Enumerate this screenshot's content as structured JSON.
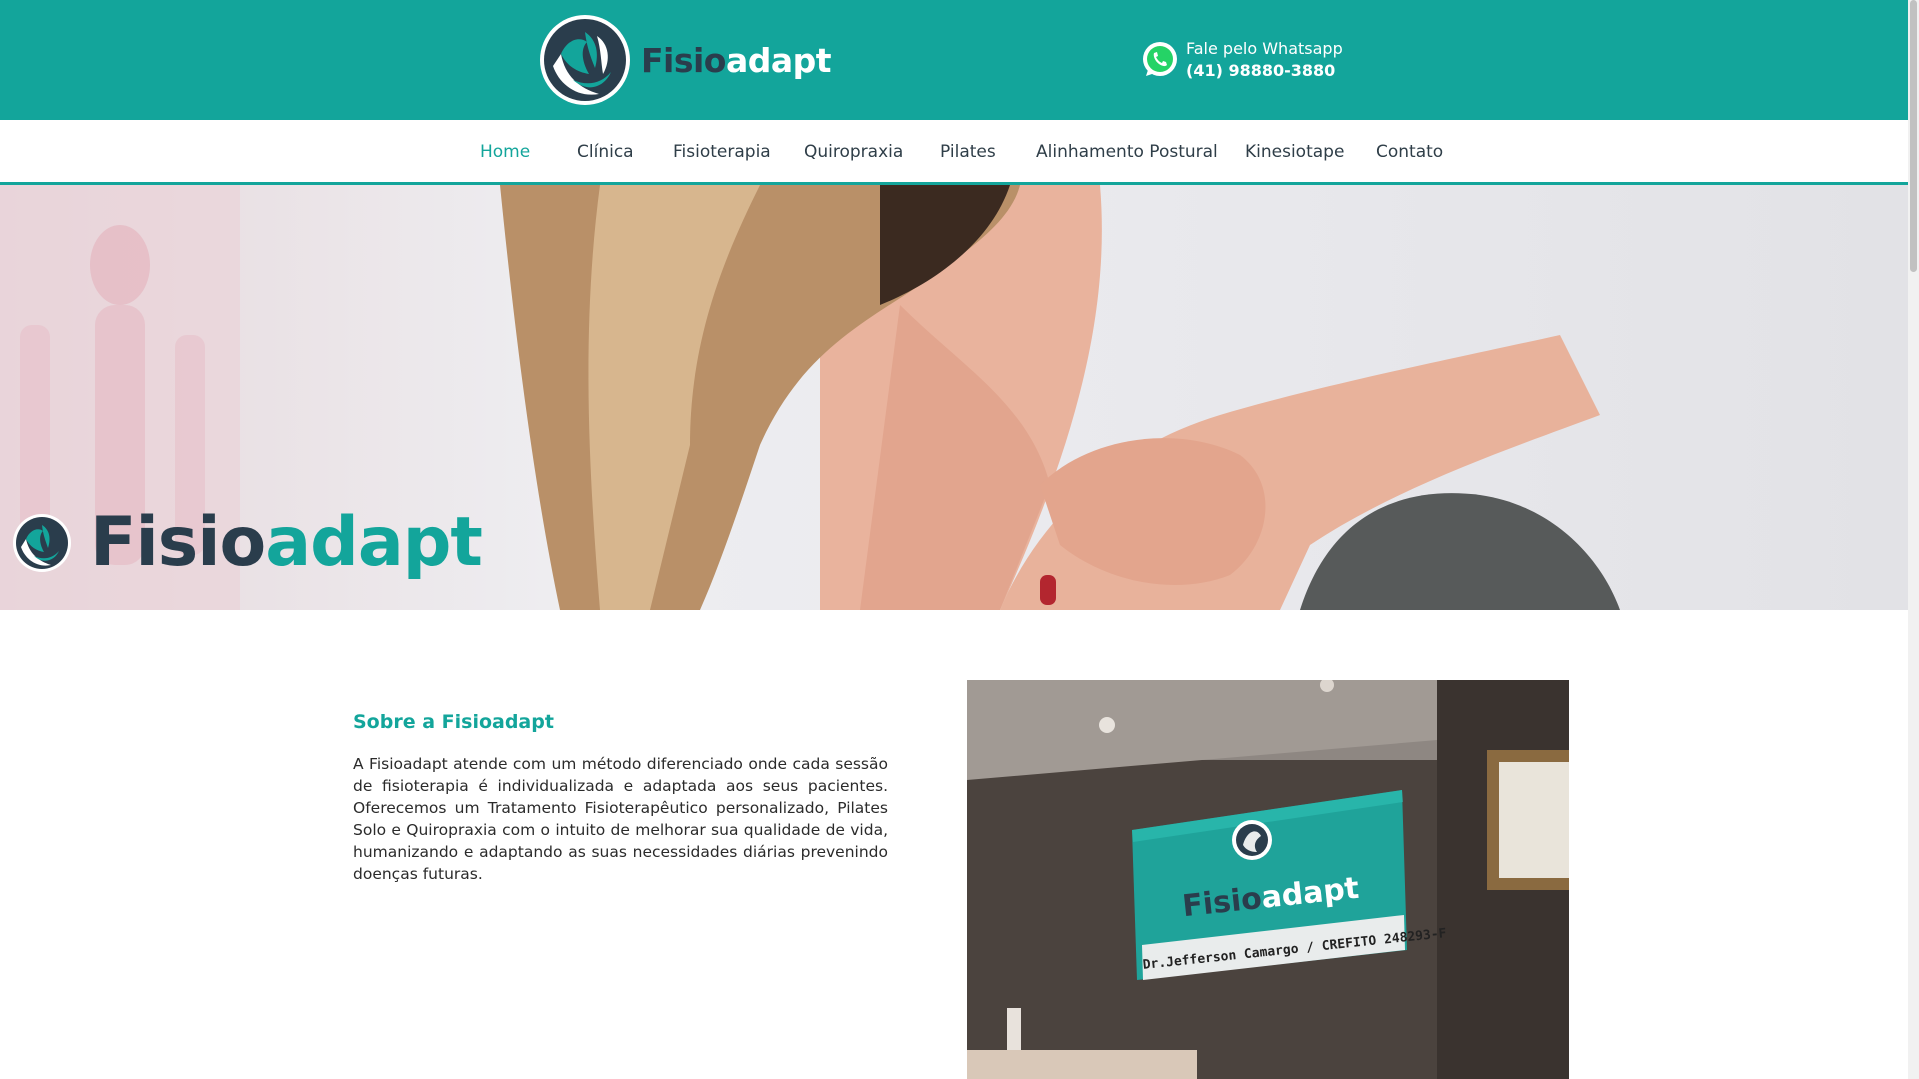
{
  "header": {
    "brand_part1": "Fisio",
    "brand_part2": "adapt",
    "whatsapp_label": "Fale pelo Whatsapp",
    "whatsapp_phone": "(41) 98880-3880"
  },
  "nav": {
    "items": [
      {
        "label": "Home",
        "active": true
      },
      {
        "label": "Clínica"
      },
      {
        "label": "Fisioterapia"
      },
      {
        "label": "Quiropraxia"
      },
      {
        "label": "Pilates"
      },
      {
        "label": "Alinhamento Postural"
      },
      {
        "label": "Kinesiotape"
      },
      {
        "label": "Contato"
      }
    ]
  },
  "hero": {
    "brand_part1": "Fisio",
    "brand_part2": "adapt"
  },
  "about": {
    "title": "Sobre a Fisioadapt",
    "text": "A Fisioadapt atende com um método diferenciado onde cada sessão de fisioterapia é individualizada e adaptada aos seus pacientes. Oferecemos um Tratamento Fisioterapêutico personalizado, Pilates Solo e Quiropraxia com o intuito de melhorar sua qualidade de vida, humanizando e adaptando as suas necessidades diárias prevenindo doenças futuras.",
    "sign_brand_part1": "Fisio",
    "sign_brand_part2": "adapt",
    "sign_subtitle": "Dr.Jefferson Camargo / CREFITO 248293-F"
  },
  "colors": {
    "primary": "#13a59b",
    "dark": "#2a3d4c",
    "whatsapp": "#25d366"
  }
}
